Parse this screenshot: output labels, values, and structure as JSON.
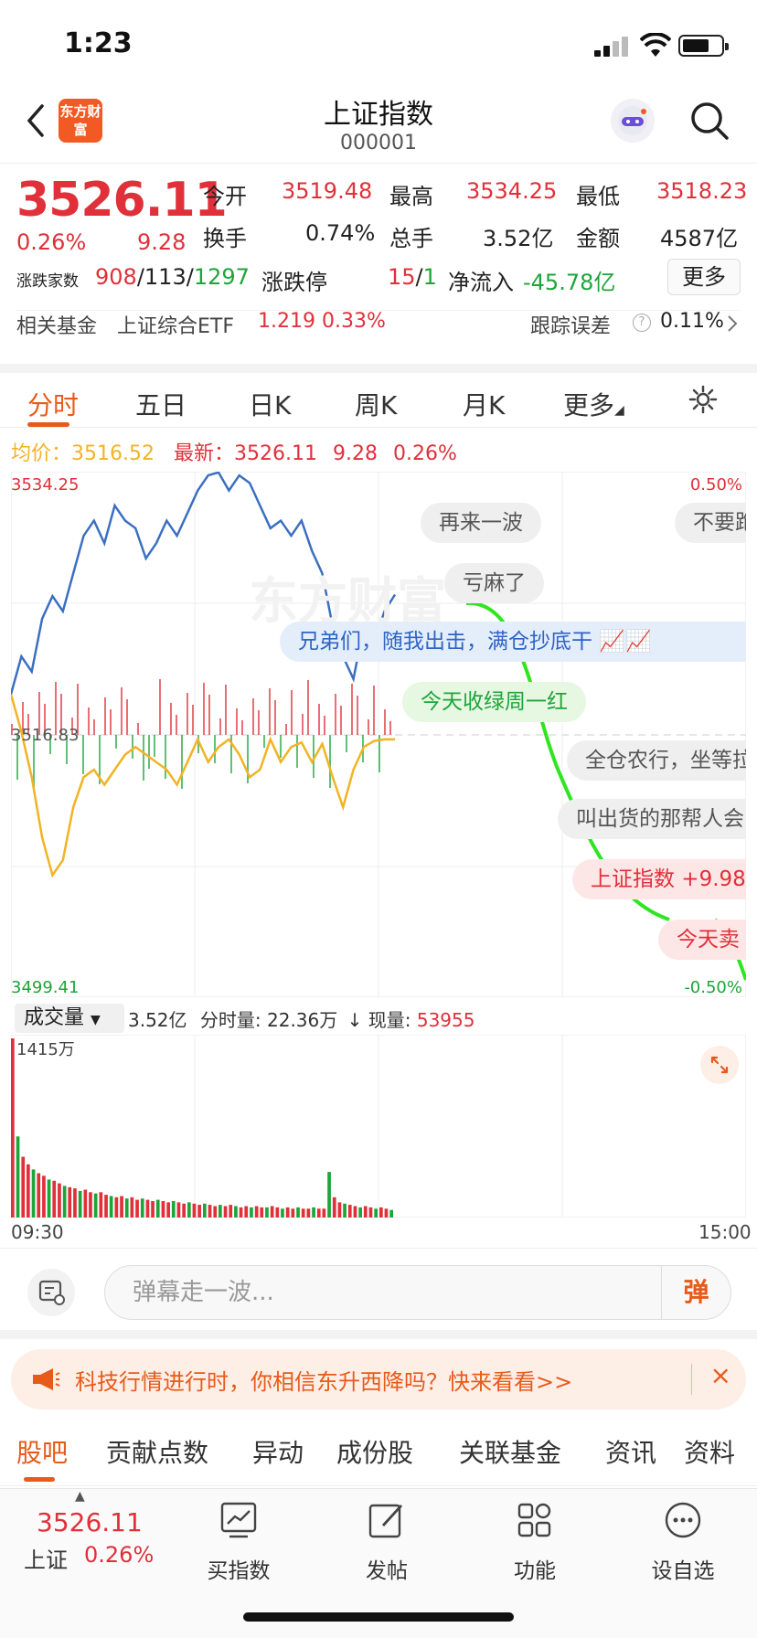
{
  "status_bar": {
    "time": "1:23"
  },
  "header": {
    "logo_text": "东方财富",
    "title": "上证指数",
    "code": "000001"
  },
  "quote": {
    "price": "3526.11",
    "change_pct": "0.26%",
    "change": "9.28",
    "open_label": "今开",
    "open": "3519.48",
    "high_label": "最高",
    "high": "3534.25",
    "low_label": "最低",
    "low": "3518.23",
    "turnover_label": "换手",
    "turnover": "0.74%",
    "volume_label": "总手",
    "volume": "3.52亿",
    "amount_label": "金额",
    "amount": "4587亿",
    "breadth_label": "涨跌家数",
    "up": "908",
    "flat": "113",
    "down": "1297",
    "limit_label": "涨跌停",
    "limit_up": "15",
    "limit_down": "1",
    "netflow_label": "净流入",
    "netflow": "-45.78亿",
    "more_label": "更多",
    "fund_label": "相关基金",
    "fund_name": "上证综合ETF",
    "fund_price": "1.219",
    "fund_pct": "0.33%",
    "tracking_label": "跟踪误差",
    "tracking_value": "0.11%"
  },
  "tabs": [
    "分时",
    "五日",
    "日K",
    "周K",
    "月K",
    "更多"
  ],
  "legend": {
    "avg_label": "均价：",
    "avg": "3516.52",
    "latest_label": "最新：",
    "latest": "3526.11",
    "change": "9.28",
    "pct": "0.26%"
  },
  "chart_data": [
    {
      "type": "line",
      "title": "",
      "y_labels": {
        "top": "3534.25",
        "mid": "3516.83",
        "bottom": "3499.41"
      },
      "pct_labels": {
        "top": "0.50%",
        "bottom": "-0.50%"
      },
      "ylim": [
        3499.41,
        3534.25
      ],
      "x_start": "09:30",
      "x_end": "15:00",
      "series": [
        {
          "values": [
            3519.5,
            3522.0,
            3521.0,
            3524.5,
            3526.0,
            3525.0,
            3527.5,
            3530.0,
            3531.0,
            3529.5,
            3532.0,
            3531.0,
            3530.5,
            3528.5,
            3529.5,
            3531.0,
            3530.0,
            3531.5,
            3533.0,
            3534.0,
            3534.2,
            3533.0,
            3534.0,
            3533.5,
            3532.0,
            3530.5,
            3531.0,
            3530.0,
            3531.0,
            3529.0,
            3527.5,
            3524.0,
            3522.0,
            3520.5,
            3524.0,
            3523.0,
            3525.0,
            3526.1
          ]
        },
        {
          "values": [
            3519.5,
            3517.0,
            3514.0,
            3510.0,
            3507.5,
            3508.5,
            3512.0,
            3514.0,
            3514.5,
            3513.5,
            3514.5,
            3515.5,
            3516.0,
            3515.5,
            3515.0,
            3514.5,
            3513.5,
            3515.0,
            3516.5,
            3515.0,
            3516.0,
            3516.5,
            3515.5,
            3514.0,
            3514.5,
            3516.5,
            3515.0,
            3516.0,
            3516.3,
            3515.0,
            3516.2,
            3514.0,
            3512.0,
            3514.5,
            3516.0,
            3516.4,
            3516.5,
            3516.5
          ]
        }
      ]
    },
    {
      "type": "bar",
      "title": "",
      "ylabel": "1415万",
      "values": [
        1415,
        640,
        480,
        420,
        380,
        350,
        330,
        300,
        290,
        270,
        250,
        240,
        230,
        210,
        220,
        200,
        190,
        200,
        180,
        170,
        160,
        170,
        150,
        160,
        140,
        150,
        140,
        130,
        140,
        130,
        120,
        130,
        120,
        110,
        120,
        110,
        100,
        110,
        100,
        90,
        100,
        90,
        100,
        90,
        80,
        90,
        80,
        90,
        80,
        80,
        90,
        80,
        70,
        80,
        70,
        80,
        70,
        70,
        80,
        70,
        70,
        360,
        160,
        120,
        110,
        100,
        90,
        80,
        90,
        80,
        70,
        80,
        70,
        60
      ]
    }
  ],
  "danmu": [
    "再来一波",
    "不要跑",
    "亏麻了",
    "兄弟们，随我出击，满仓抄底干",
    "今天收绿周一红",
    "全仓农行，坐等拉",
    "叫出货的那帮人会",
    "上证指数 +9.98",
    "今天卖"
  ],
  "volume_bar": {
    "label": "成交量",
    "total": "3.52亿",
    "minute_label": "分时量:",
    "minute": "22.36万",
    "now_label": "现量:",
    "now": "53955"
  },
  "input": {
    "placeholder": "弹幕走一波...",
    "send_label": "弹"
  },
  "promo": {
    "text": "科技行情进行时，你相信东升西降吗？快来看看>>",
    "close": "×"
  },
  "section_tabs": [
    "股吧",
    "贡献点数",
    "异动",
    "成份股",
    "关联基金",
    "资讯",
    "资料"
  ],
  "bottom_nav": {
    "price": "3526.11",
    "name": "上证",
    "pct": "0.26%",
    "items": [
      "买指数",
      "发帖",
      "功能",
      "设自选"
    ]
  },
  "colors": {
    "accent": "#e85a1a",
    "up": "#e0303a",
    "down": "#1ea53a",
    "price_line": "#3b6fc0",
    "avg_line": "#f2b324"
  }
}
